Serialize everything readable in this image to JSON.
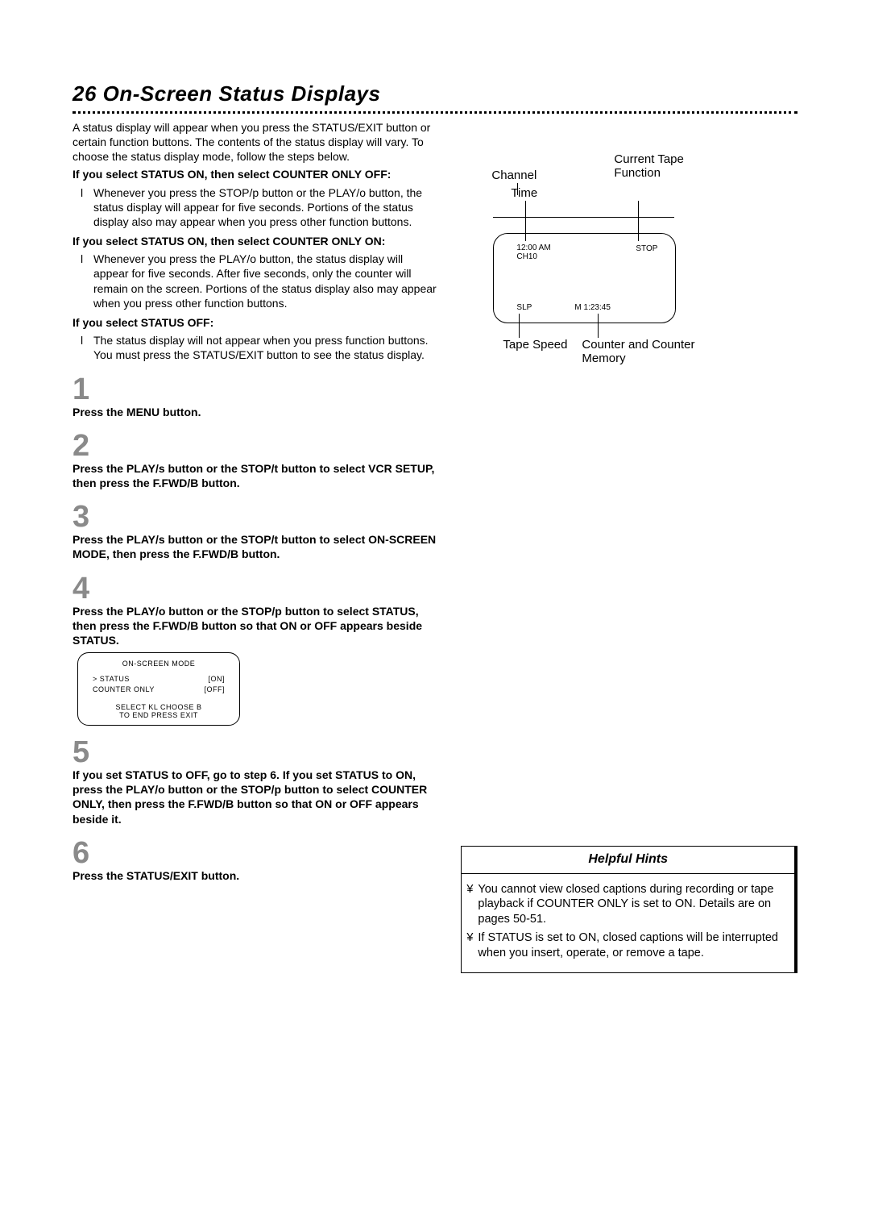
{
  "title": "26  On-Screen Status Displays",
  "intro": "A status display will appear when you press the STATUS/EXIT button or certain function buttons. The contents of the status display will vary. To choose the status display mode, follow the steps below.",
  "section1_heading": "If you select STATUS ON, then select COUNTER ONLY OFF:",
  "section1_item": "Whenever you press the STOP/p  button or the PLAY/o  button, the status display will appear for five seconds. Portions of the status display also may appear when you press other function buttons.",
  "section2_heading": "If you select STATUS ON, then select COUNTER ONLY ON:",
  "section2_item": "Whenever you press the PLAY/o  button, the status display will appear for five seconds. After five seconds, only the counter will remain on the screen. Portions of the status display also may appear when you press other function buttons.",
  "section3_heading": "If you select STATUS OFF:",
  "section3_item": "The status display will not appear when you press function buttons. You must press the STATUS/EXIT button to see the status display.",
  "steps": {
    "1": "Press the MENU button.",
    "2": "Press the PLAY/s  button or the STOP/t  button to select VCR SETUP, then press the F.FWD/B  button.",
    "3": "Press the PLAY/s  button or the STOP/t  button to select ON-SCREEN MODE, then press the F.FWD/B  button.",
    "4": "Press the PLAY/o  button or the STOP/p  button to select STATUS, then press the F.FWD/B  button so that ON or OFF appears beside STATUS.",
    "5": "If you set STATUS to OFF, go to step 6. If you set STATUS to ON, press the PLAY/o  button or the STOP/p  button to select COUNTER ONLY, then press the F.FWD/B  button so that ON or OFF appears beside it.",
    "6": "Press the STATUS/EXIT button."
  },
  "menu_box": {
    "title": "ON-SCREEN MODE",
    "rows": [
      {
        "label": "> STATUS",
        "value": "[ON]"
      },
      {
        "label": "  COUNTER ONLY",
        "value": "[OFF]"
      }
    ],
    "footer1": "SELECT KL  CHOOSE B",
    "footer2": "TO  END  PRESS  EXIT"
  },
  "diagram": {
    "label_channel": "Channel",
    "label_time": "Time",
    "label_current": "Current Tape Function",
    "label_tape_speed": "Tape Speed",
    "label_counter": "Counter and Counter Memory",
    "screen_time": "12:00 AM",
    "screen_channel": "CH10",
    "screen_stop": "STOP",
    "screen_slp": "SLP",
    "screen_counter": "M   1:23:45"
  },
  "hints": {
    "title": "Helpful Hints",
    "items": [
      "You cannot view closed captions during recording or tape playback if COUNTER ONLY is set to ON. Details are on pages 50-51.",
      "If STATUS is set to ON, closed captions will be interrupted when you insert, operate, or remove a tape."
    ]
  },
  "bullet_mark": "l",
  "hint_mark": "¥"
}
